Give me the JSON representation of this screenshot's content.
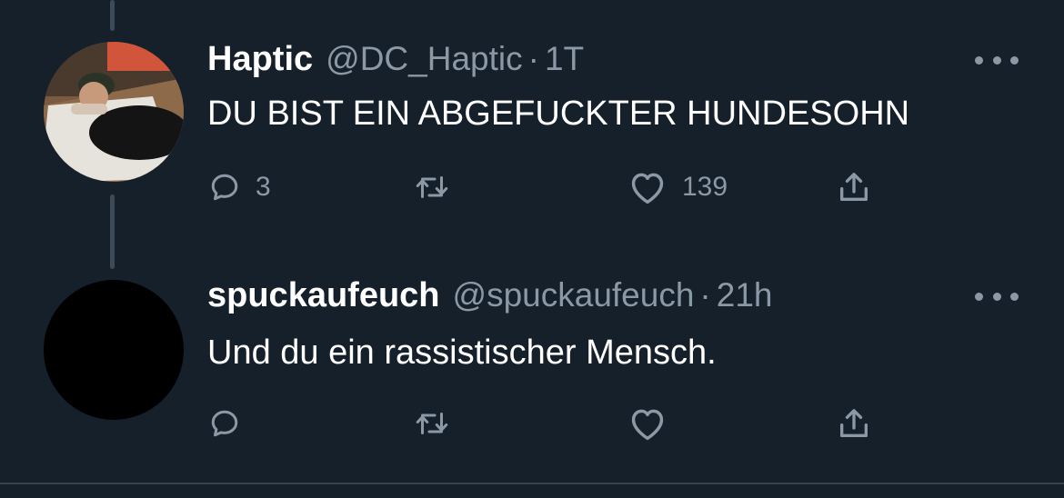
{
  "theme": {
    "background": "#15202b",
    "text_primary": "#ffffff",
    "text_secondary": "#8b98a5",
    "thread_line": "#3d4b59"
  },
  "tweets": [
    {
      "name": "Haptic",
      "handle": "@DC_Haptic",
      "separator": "·",
      "time": "1T",
      "text": "DU BIST EIN ABGEFUCKTER HUNDESOHN",
      "reply_count": "3",
      "retweet_count": "",
      "like_count": "139",
      "icons": {
        "reply": "reply-icon",
        "retweet": "retweet-icon",
        "like": "heart-icon",
        "share": "share-icon",
        "more": "more-icon"
      }
    },
    {
      "name": "spuckaufeuch",
      "handle": "@spuckaufeuch",
      "separator": "·",
      "time": "21h",
      "text": "Und du ein rassistischer Mensch.",
      "reply_count": "",
      "retweet_count": "",
      "like_count": "",
      "icons": {
        "reply": "reply-icon",
        "retweet": "retweet-icon",
        "like": "heart-icon",
        "share": "share-icon",
        "more": "more-icon"
      }
    }
  ]
}
